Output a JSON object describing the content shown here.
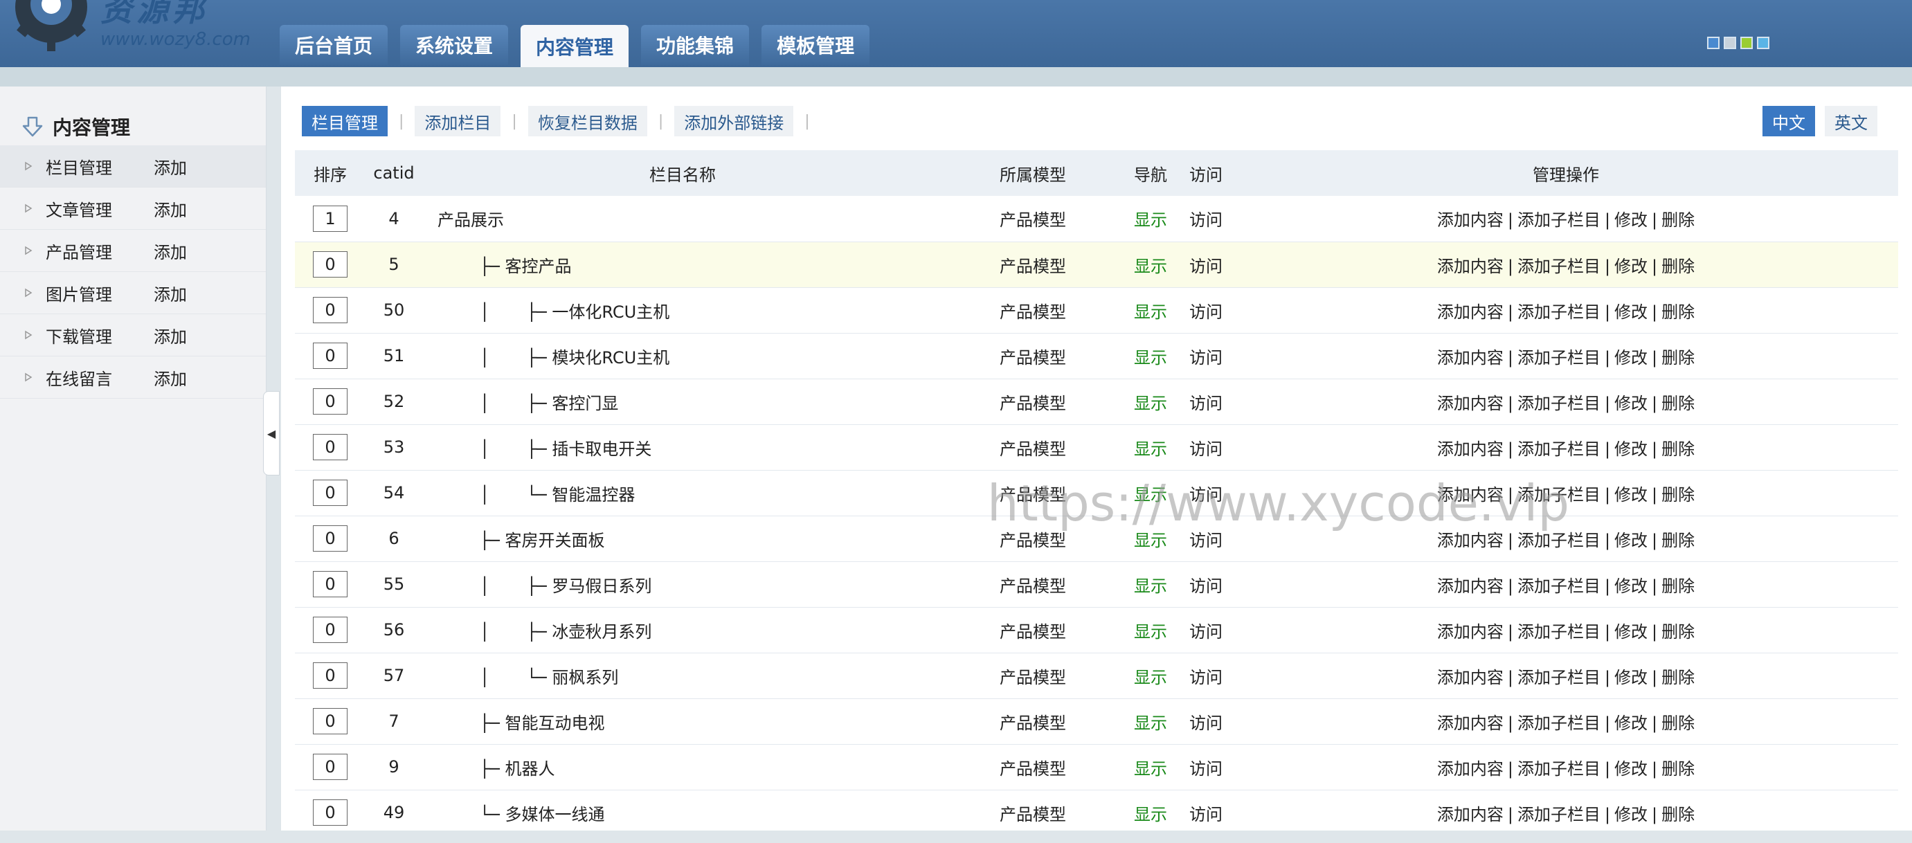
{
  "header": {
    "logo_text": "资源邦",
    "logo_sub": "www.wozy8.com",
    "nav_tabs": [
      {
        "label": "后台首页",
        "active": false
      },
      {
        "label": "系统设置",
        "active": false
      },
      {
        "label": "内容管理",
        "active": true
      },
      {
        "label": "功能集锦",
        "active": false
      },
      {
        "label": "模板管理",
        "active": false
      }
    ],
    "skin_colors": [
      "#4a8ad0",
      "#c9d3dc",
      "#9acd32",
      "#5ab4e6"
    ]
  },
  "sidebar": {
    "title": "内容管理",
    "items": [
      {
        "label": "栏目管理",
        "add": "添加"
      },
      {
        "label": "文章管理",
        "add": "添加"
      },
      {
        "label": "产品管理",
        "add": "添加"
      },
      {
        "label": "图片管理",
        "add": "添加"
      },
      {
        "label": "下载管理",
        "add": "添加"
      },
      {
        "label": "在线留言",
        "add": "添加"
      }
    ],
    "collapse_glyph": "◀"
  },
  "toolbar": {
    "tabs": [
      "栏目管理",
      "添加栏目",
      "恢复栏目数据",
      "添加外部链接"
    ],
    "separator": "|",
    "lang": [
      "中文",
      "英文"
    ]
  },
  "table": {
    "headers": [
      "排序",
      "catid",
      "栏目名称",
      "所属模型",
      "导航",
      "访问",
      "管理操作"
    ],
    "ops": [
      "添加内容",
      "添加子栏目",
      "修改",
      "删除"
    ],
    "rows": [
      {
        "order": "1",
        "catid": "4",
        "name": "产品展示",
        "model": "产品模型",
        "nav": "显示",
        "visit": "访问"
      },
      {
        "order": "0",
        "catid": "5",
        "name": "        ├─ 客控产品",
        "model": "产品模型",
        "nav": "显示",
        "visit": "访问"
      },
      {
        "order": "0",
        "catid": "50",
        "name": "        │       ├─ 一体化RCU主机",
        "model": "产品模型",
        "nav": "显示",
        "visit": "访问"
      },
      {
        "order": "0",
        "catid": "51",
        "name": "        │       ├─ 模块化RCU主机",
        "model": "产品模型",
        "nav": "显示",
        "visit": "访问"
      },
      {
        "order": "0",
        "catid": "52",
        "name": "        │       ├─ 客控门显",
        "model": "产品模型",
        "nav": "显示",
        "visit": "访问"
      },
      {
        "order": "0",
        "catid": "53",
        "name": "        │       ├─ 插卡取电开关",
        "model": "产品模型",
        "nav": "显示",
        "visit": "访问"
      },
      {
        "order": "0",
        "catid": "54",
        "name": "        │       └─ 智能温控器",
        "model": "产品模型",
        "nav": "显示",
        "visit": "访问"
      },
      {
        "order": "0",
        "catid": "6",
        "name": "        ├─ 客房开关面板",
        "model": "产品模型",
        "nav": "显示",
        "visit": "访问"
      },
      {
        "order": "0",
        "catid": "55",
        "name": "        │       ├─ 罗马假日系列",
        "model": "产品模型",
        "nav": "显示",
        "visit": "访问"
      },
      {
        "order": "0",
        "catid": "56",
        "name": "        │       ├─ 冰壶秋月系列",
        "model": "产品模型",
        "nav": "显示",
        "visit": "访问"
      },
      {
        "order": "0",
        "catid": "57",
        "name": "        │       └─ 丽枫系列",
        "model": "产品模型",
        "nav": "显示",
        "visit": "访问"
      },
      {
        "order": "0",
        "catid": "7",
        "name": "        ├─ 智能互动电视",
        "model": "产品模型",
        "nav": "显示",
        "visit": "访问"
      },
      {
        "order": "0",
        "catid": "9",
        "name": "        ├─ 机器人",
        "model": "产品模型",
        "nav": "显示",
        "visit": "访问"
      },
      {
        "order": "0",
        "catid": "49",
        "name": "        └─ 多媒体一线通",
        "model": "产品模型",
        "nav": "显示",
        "visit": "访问"
      }
    ]
  },
  "watermark": "https://www.xycode.vip"
}
